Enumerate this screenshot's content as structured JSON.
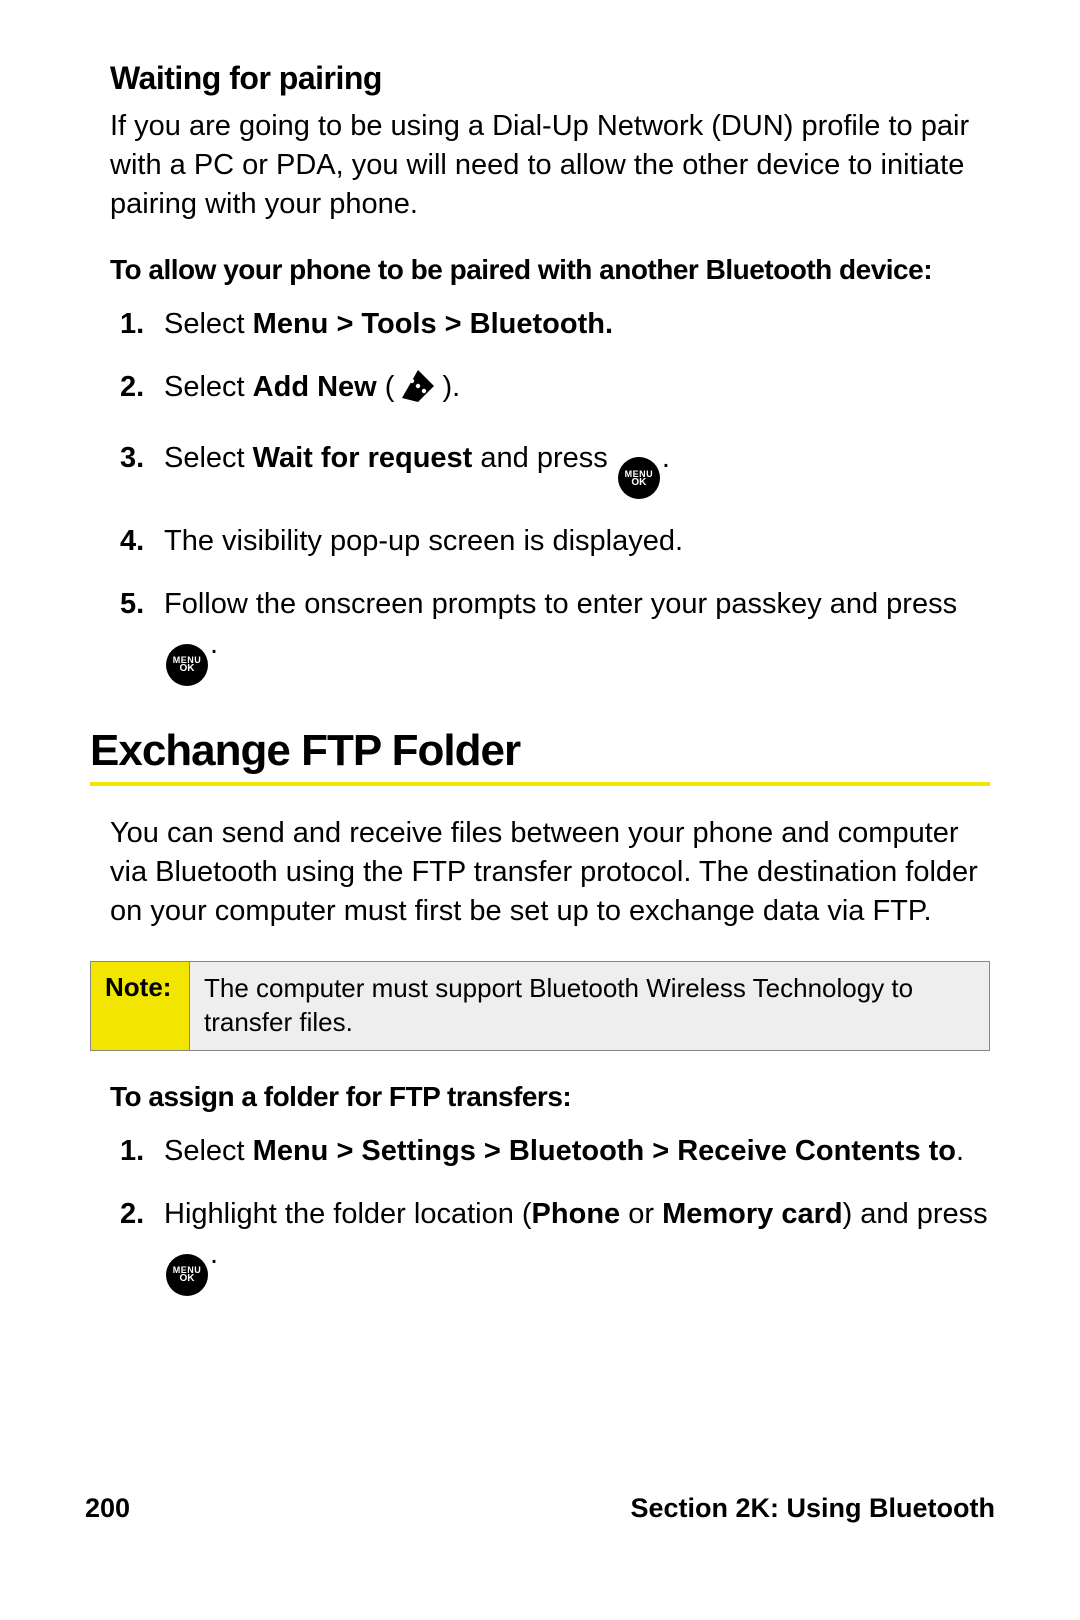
{
  "section1": {
    "heading": "Waiting for pairing",
    "intro": "If you are going to be using a Dial-Up Network (DUN) profile to pair with a PC or PDA, you will need to allow the other device to initiate pairing with your phone.",
    "subhead": "To allow your phone to be paired with another Bluetooth device:",
    "steps": {
      "s1_a": "Select ",
      "s1_b": "Menu > Tools > Bluetooth.",
      "s2_a": "Select ",
      "s2_b": "Add New",
      "s2_c": " (",
      "s2_d": ").",
      "s3_a": "Select ",
      "s3_b": "Wait for request",
      "s3_c": " and press ",
      "s3_d": ".",
      "s4": "The visibility pop-up screen is displayed.",
      "s5_a": "Follow the onscreen prompts to enter your passkey and press ",
      "s5_b": "."
    }
  },
  "section2": {
    "title": "Exchange FTP Folder",
    "intro": "You can send and receive files between your phone and computer via Bluetooth using the FTP transfer protocol. The destination folder on your computer must first be set up to exchange data via FTP.",
    "note_label": "Note:",
    "note_text": "The computer must support Bluetooth Wireless Technology to transfer files.",
    "subhead": "To assign a folder for FTP transfers:",
    "steps": {
      "s1_a": "Select ",
      "s1_b": "Menu > Settings > Bluetooth > Receive Contents to",
      "s1_c": ".",
      "s2_a": "Highlight the folder location (",
      "s2_b": "Phone",
      "s2_c": " or ",
      "s2_d": "Memory card",
      "s2_e": ") and press ",
      "s2_f": "."
    }
  },
  "footer": {
    "page_number": "200",
    "section_label": "Section 2K: Using Bluetooth"
  },
  "icons": {
    "menu": "MENU",
    "ok": "OK"
  }
}
